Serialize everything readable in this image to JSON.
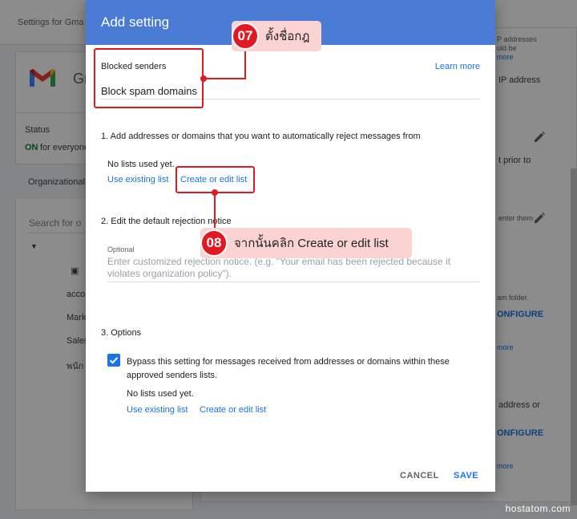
{
  "background": {
    "breadcrumb": "Settings for Gma",
    "app_name_partial": "Gn",
    "status_label": "Status",
    "status_on": "ON",
    "status_rest": "for everyone",
    "org_units_label": "Organizational",
    "search_placeholder": "Search for o",
    "tree_items": [
      "acco",
      "Mark",
      "Sales",
      "พนัก"
    ],
    "right_snippets": {
      "ip_addresses": "P addresses",
      "would_be": "uld be",
      "more1": "more",
      "ip_address": "IP address",
      "prior_to": "t prior to",
      "enter_them": "enter them",
      "am_folder": "am folder.",
      "configure1": "ONFIGURE",
      "more2": "more",
      "address_or": "address or",
      "configure2": "ONFIGURE",
      "more3": "more"
    }
  },
  "dialog": {
    "title": "Add setting",
    "field_label": "Blocked senders",
    "field_value": "Block spam domains",
    "learn_more": "Learn more",
    "section1": "1. Add addresses or domains that you want to automatically reject messages from",
    "section1_empty": "No lists used yet.",
    "section1_use_existing": "Use existing list",
    "section1_create_edit": "Create or edit list",
    "section2": "2. Edit the default rejection notice",
    "optional_label": "Optional",
    "notice_placeholder": "Enter customized rejection notice. (e.g. \"Your email has been rejected because it violates organization policy\").",
    "section3": "3. Options",
    "bypass_label": "Bypass this setting for messages received from addresses or domains within these approved senders lists.",
    "bypass_checked": true,
    "section3_empty": "No lists used yet.",
    "section3_use_existing": "Use existing list",
    "section3_create_edit": "Create or edit list",
    "cancel": "CANCEL",
    "save": "SAVE"
  },
  "annotations": {
    "step7_number": "07",
    "step7_text": "ตั้งชื่อกฎ",
    "step8_number": "08",
    "step8_text": "จากนั้นคลิก Create or edit list"
  },
  "watermark": "hostatom.com",
  "colors": {
    "header_blue": "#4a7bd5",
    "link_blue": "#1a73e8",
    "annotation_red": "#e11a22",
    "callout_pink": "#fcd3d3",
    "status_green": "#188038"
  }
}
